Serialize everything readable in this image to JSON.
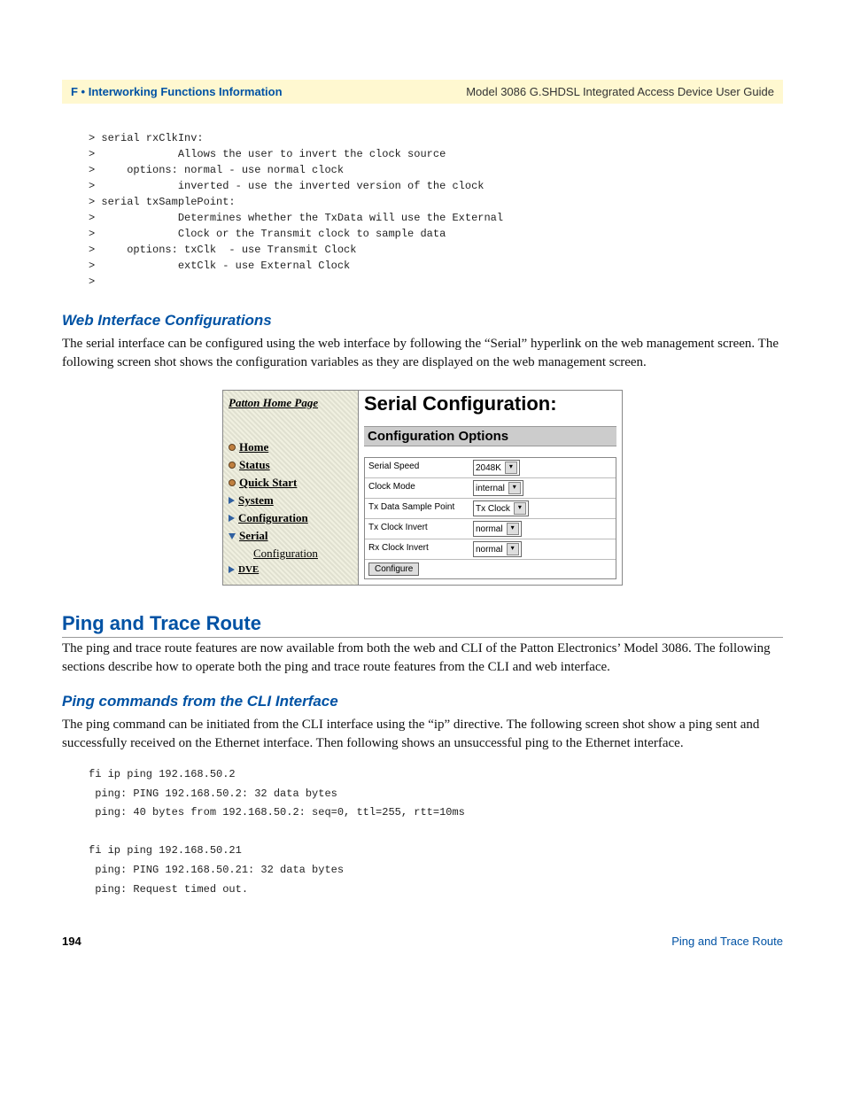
{
  "header": {
    "left": "F • Interworking Functions Information",
    "right": "Model 3086 G.SHDSL Integrated Access Device User Guide"
  },
  "code1": "> serial rxClkInv:\n>             Allows the user to invert the clock source\n>     options: normal - use normal clock\n>             inverted - use the inverted version of the clock\n> serial txSamplePoint:\n>             Determines whether the TxData will use the External\n>             Clock or the Transmit clock to sample data\n>     options: txClk  - use Transmit Clock\n>             extClk - use External Clock\n>",
  "sub1": "Web Interface Configurations",
  "para1": "The serial interface can be configured using the web interface by following the “Serial” hyperlink on the web management screen. The following screen shot shows the configuration variables as they are displayed on the web management screen.",
  "figure": {
    "patton": "Patton Home Page",
    "nav": {
      "home": "Home",
      "status": "Status",
      "quick": "Quick Start",
      "system": "System",
      "config": "Configuration",
      "serial": "Serial",
      "serial_sub": "Configuration",
      "dve": "DVE"
    },
    "title": "Serial Configuration:",
    "subtitle": "Configuration Options",
    "rows": {
      "r1": {
        "label": "Serial Speed",
        "value": "2048K"
      },
      "r2": {
        "label": "Clock Mode",
        "value": "internal"
      },
      "r3": {
        "label": "Tx Data Sample Point",
        "value": "Tx Clock"
      },
      "r4": {
        "label": "Tx Clock Invert",
        "value": "normal"
      },
      "r5": {
        "label": "Rx Clock Invert",
        "value": "normal"
      }
    },
    "button": "Configure"
  },
  "heading2": "Ping and Trace Route",
  "para2": "The ping and trace route features are now available from both the web and CLI of the Patton Electronics’ Model 3086. The following sections describe how to operate both the ping and trace route features from the CLI and web interface.",
  "sub2": "Ping commands from the CLI Interface",
  "para3": "The ping command can be initiated from the CLI interface using the “ip” directive. The following screen shot show a ping sent and successfully received on the Ethernet interface. Then following shows an unsuccessful ping to the Ethernet interface.",
  "code2": "fi ip ping 192.168.50.2\n ping: PING 192.168.50.2: 32 data bytes\n ping: 40 bytes from 192.168.50.2: seq=0, ttl=255, rtt=10ms\n\nfi ip ping 192.168.50.21\n ping: PING 192.168.50.21: 32 data bytes\n ping: Request timed out.",
  "footer": {
    "page": "194",
    "section": "Ping and Trace Route"
  }
}
